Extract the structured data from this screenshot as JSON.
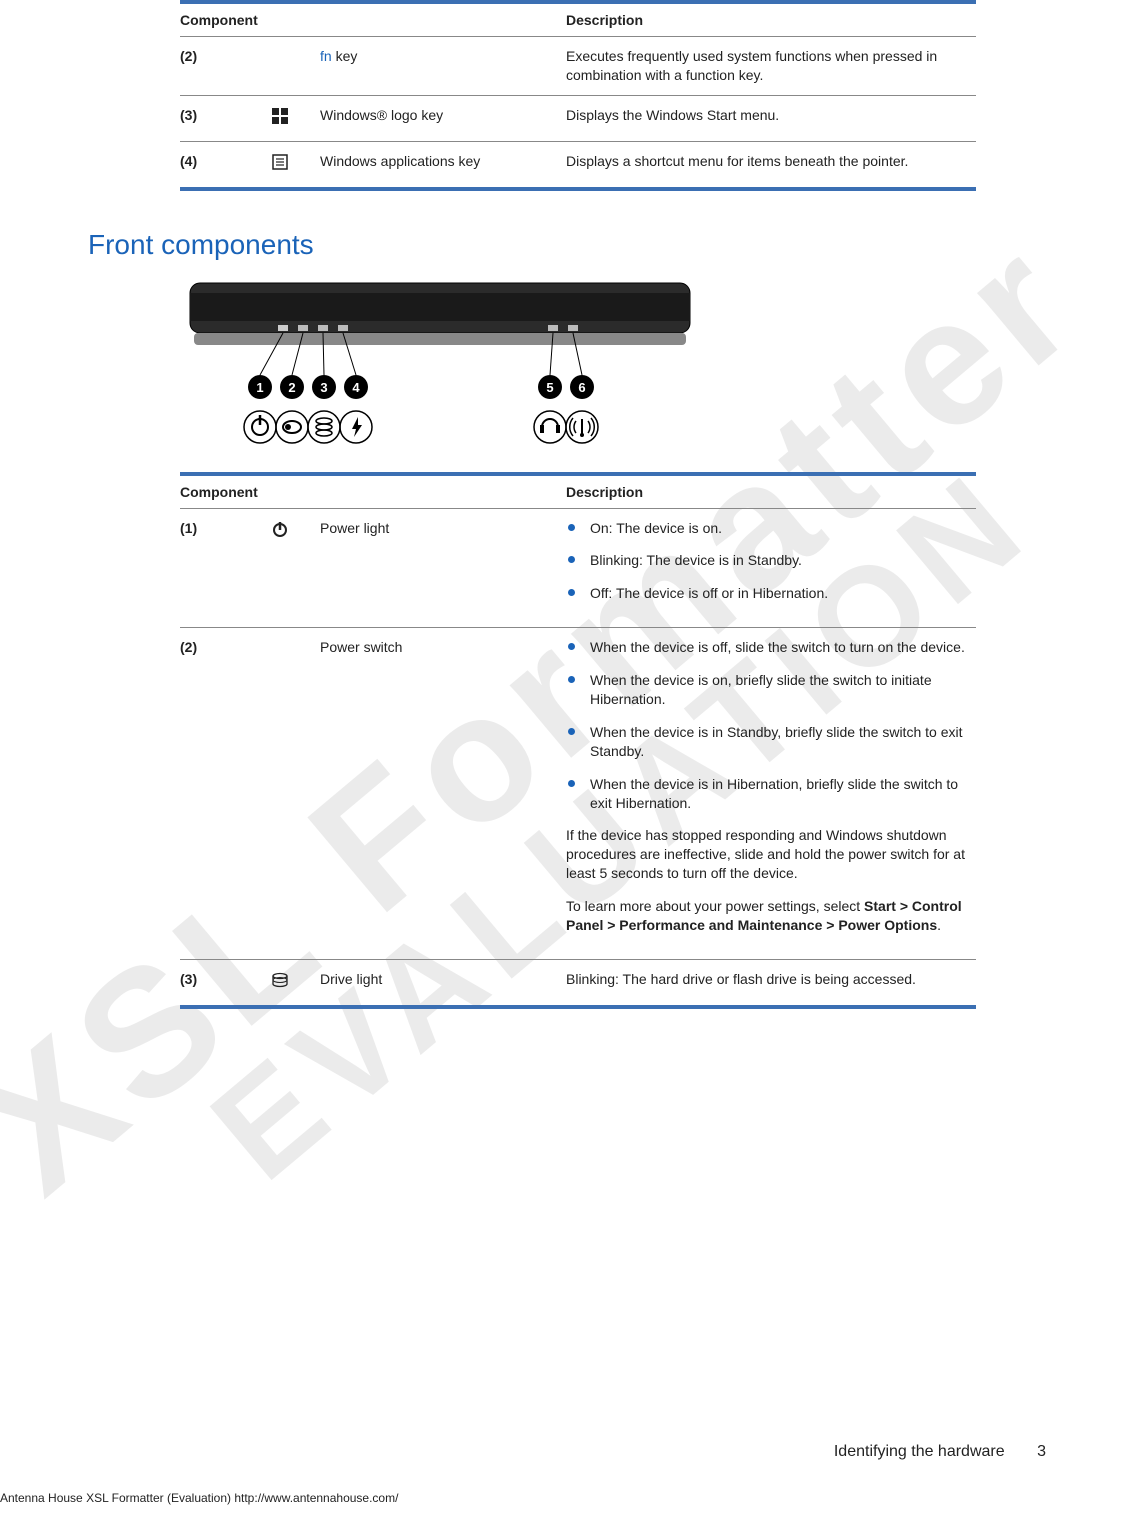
{
  "watermark": {
    "line1": "XSL Formatter",
    "line2": "EVALUATION"
  },
  "table1": {
    "headers": {
      "component": "Component",
      "description": "Description"
    },
    "rows": [
      {
        "num": "(2)",
        "icon": "",
        "name_prefix": "fn",
        "name_suffix": " key",
        "desc": "Executes frequently used system functions when pressed in combination with a function key."
      },
      {
        "num": "(3)",
        "icon": "windows-logo",
        "name": "Windows® logo key",
        "desc": "Displays the Windows Start menu."
      },
      {
        "num": "(4)",
        "icon": "applications",
        "name": "Windows applications key",
        "desc": "Displays a shortcut menu for items beneath the pointer."
      }
    ]
  },
  "heading": "Front components",
  "table2": {
    "headers": {
      "component": "Component",
      "description": "Description"
    },
    "rows": {
      "r1": {
        "num": "(1)",
        "icon": "power",
        "name": "Power light",
        "bullets": [
          "On: The device is on.",
          "Blinking: The device is in Standby.",
          "Off: The device is off or in Hibernation."
        ]
      },
      "r2": {
        "num": "(2)",
        "icon": "",
        "name": "Power switch",
        "bullets": [
          "When the device is off, slide the switch to turn on the device.",
          "When the device is on, briefly slide the switch to initiate Hibernation.",
          "When the device is in Standby, briefly slide the switch to exit Standby.",
          "When the device is in Hibernation, briefly slide the switch to exit Hibernation."
        ],
        "p1": "If the device has stopped responding and Windows shutdown procedures are ineffective, slide and hold the power switch for at least 5 seconds to turn off the device.",
        "p2_prefix": "To learn more about your power settings, select ",
        "p2_bold": "Start > Control Panel > Performance and Maintenance > Power Options",
        "p2_suffix": "."
      },
      "r3": {
        "num": "(3)",
        "icon": "drive",
        "name": "Drive light",
        "desc": "Blinking: The hard drive or flash drive is being accessed."
      }
    }
  },
  "footer": {
    "section": "Identifying the hardware",
    "page": "3",
    "generator": "Antenna House XSL Formatter (Evaluation)  http://www.antennahouse.com/"
  }
}
